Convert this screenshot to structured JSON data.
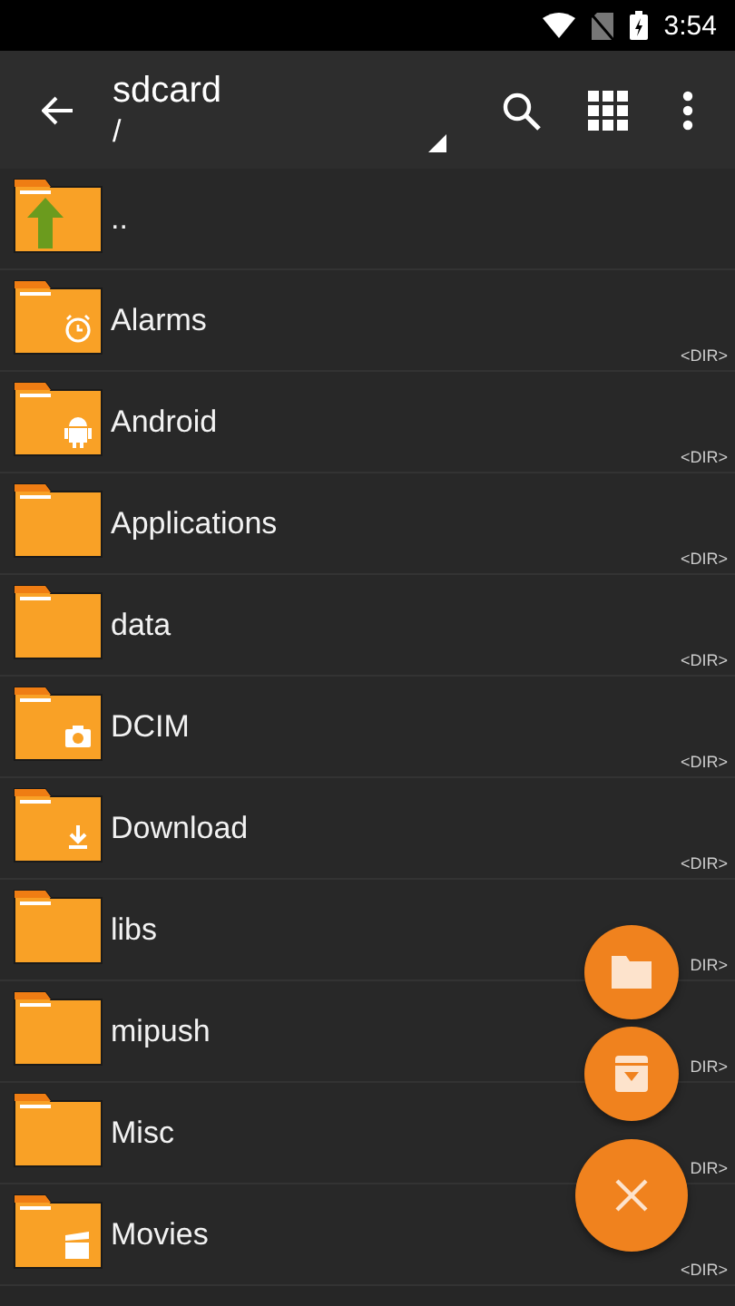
{
  "status_bar": {
    "time": "3:54"
  },
  "toolbar": {
    "title": "sdcard",
    "path": "/"
  },
  "files": [
    {
      "name": "..",
      "kind": "up"
    },
    {
      "name": "Alarms",
      "kind": "alarm",
      "tag": "<DIR>"
    },
    {
      "name": "Android",
      "kind": "android",
      "tag": "<DIR>"
    },
    {
      "name": "Applications",
      "kind": "plain",
      "tag": "<DIR>"
    },
    {
      "name": "data",
      "kind": "plain",
      "tag": "<DIR>"
    },
    {
      "name": "DCIM",
      "kind": "camera",
      "tag": "<DIR>"
    },
    {
      "name": "Download",
      "kind": "download",
      "tag": "<DIR>"
    },
    {
      "name": "libs",
      "kind": "plain",
      "tag": "DIR>"
    },
    {
      "name": "mipush",
      "kind": "plain",
      "tag": "DIR>"
    },
    {
      "name": "Misc",
      "kind": "plain",
      "tag": "DIR>"
    },
    {
      "name": "Movies",
      "kind": "movie",
      "tag": "<DIR>"
    }
  ],
  "fab_actions": [
    {
      "kind": "folder"
    },
    {
      "kind": "archive"
    },
    {
      "kind": "close"
    }
  ]
}
